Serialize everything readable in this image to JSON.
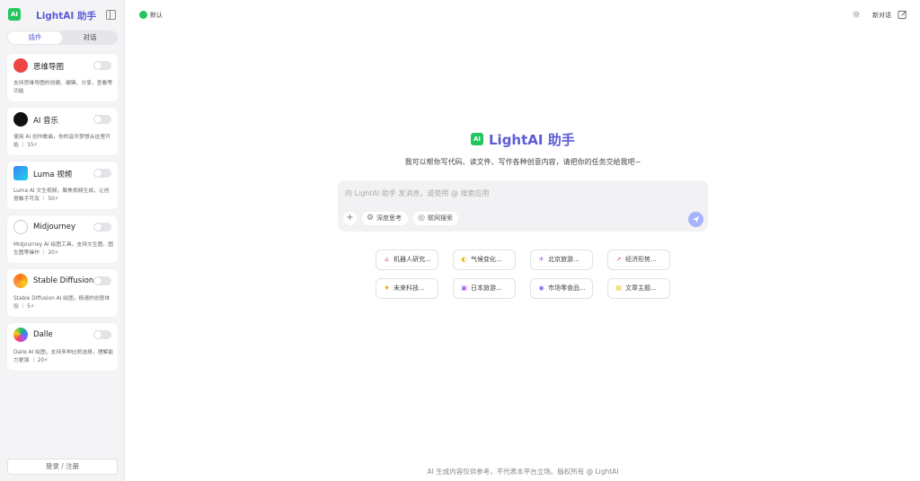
{
  "sidebar": {
    "logo_text": "AI",
    "title": "LightAI 助手",
    "tabs": [
      {
        "label": "插件"
      },
      {
        "label": "对话"
      }
    ],
    "plugins": [
      {
        "name": "思维导图",
        "icon": "mindmap-icon",
        "desc": "支持思维导图的创建、编辑、分享、查看等功能"
      },
      {
        "name": "AI 音乐",
        "icon": "music-icon",
        "desc": "使用 AI 创作歌曲，你的音乐梦想从这里开始 ｜ 15⚡"
      },
      {
        "name": "Luma 视频",
        "icon": "luma-icon",
        "desc": "Luma AI 文生视频，聚焦视频生成，让创意触手可及 ｜ 50⚡"
      },
      {
        "name": "Midjourney",
        "icon": "midjourney-icon",
        "desc": "Midjourney AI 绘图工具，支持文生图、图生图等操作 ｜ 20⚡"
      },
      {
        "name": "Stable Diffusion",
        "icon": "stable-diffusion-icon",
        "desc": "Stable Diffusion AI 绘图，极速的创意体验 ｜ 5⚡"
      },
      {
        "name": "Dalle",
        "icon": "dalle-icon",
        "desc": "Dalle AI 绘图，支持多种比例选择，理解能力更强 ｜ 20⚡"
      }
    ],
    "login_label": "登录 / 注册"
  },
  "header": {
    "status_label": "默认",
    "new_chat_label": "新对话"
  },
  "hero": {
    "logo_text": "AI",
    "title": "LightAI 助手",
    "subtitle": "我可以帮你写代码、读文件、写作各种创意内容，请把你的任务交给我吧~"
  },
  "composer": {
    "placeholder": "向 LightAI 助手 发消息，或使用 @ 搜索应用",
    "value": "",
    "deep_think_label": "深度思考",
    "web_search_label": "联网搜索"
  },
  "suggestions": [
    {
      "label": "机器人研究...",
      "icon": "robot-icon",
      "color": "#ec4899"
    },
    {
      "label": "气候变化...",
      "icon": "climate-icon",
      "color": "#eab308"
    },
    {
      "label": "北京旅游...",
      "icon": "travel-icon",
      "color": "#a855f7"
    },
    {
      "label": "经济形势...",
      "icon": "chart-icon",
      "color": "#f43f5e"
    },
    {
      "label": "未来科技...",
      "icon": "bulb-icon",
      "color": "#eab308"
    },
    {
      "label": "日本旅游...",
      "icon": "calendar-icon",
      "color": "#a855f7"
    },
    {
      "label": "市场零食品...",
      "icon": "bag-icon",
      "color": "#8b5cf6"
    },
    {
      "label": "文章主题...",
      "icon": "note-icon",
      "color": "#eab308"
    }
  ],
  "footer": "AI 生成内容仅供参考，不代表本平台立场。版权所有 @ LightAI",
  "colors": {
    "accent": "#5b5bd6",
    "status_green": "#22c55e"
  }
}
